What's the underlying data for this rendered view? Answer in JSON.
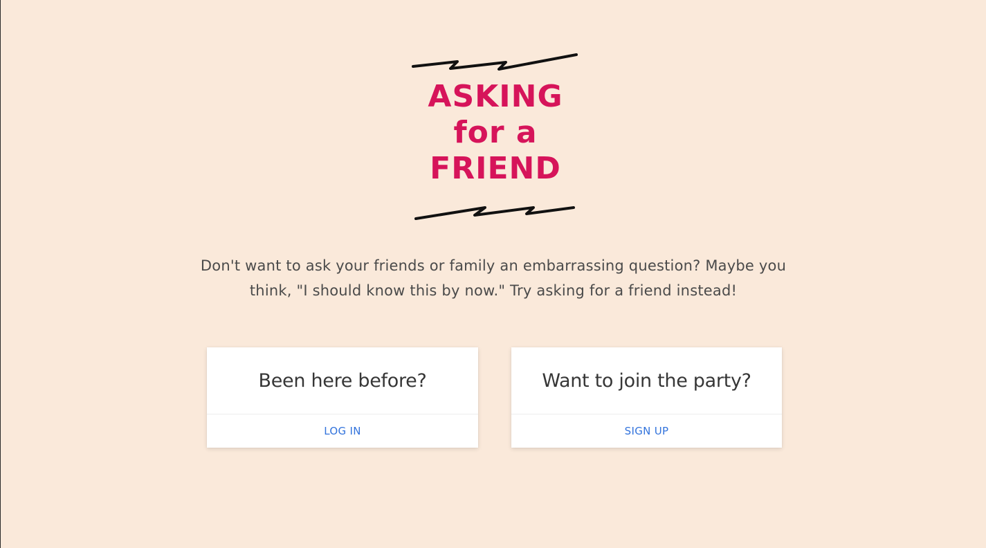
{
  "logo": {
    "lines": [
      "ASKING",
      "for a",
      "FRIEND"
    ],
    "color": "#d6145a"
  },
  "tagline": "Don't want to ask your friends or family an embarrassing question? Maybe you think, \"I should know this by now.\" Try asking for a friend instead!",
  "login_card": {
    "title": "Been here before?",
    "link": "LOG IN"
  },
  "signup_card": {
    "title": "Want to join the party?",
    "link": "SIGN UP"
  },
  "colors": {
    "background": "#fae9da",
    "accent": "#d6145a",
    "link": "#3273dc"
  }
}
